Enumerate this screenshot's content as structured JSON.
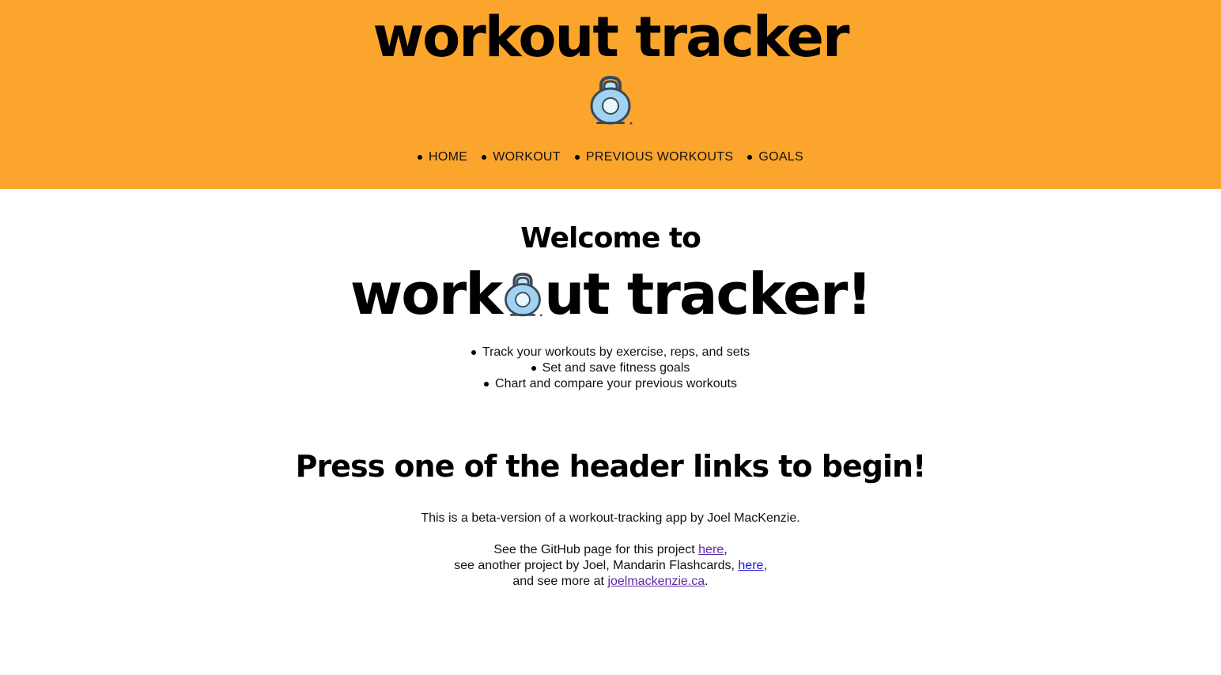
{
  "header": {
    "title": "workout tracker",
    "logo_icon": "kettlebell-icon",
    "background": "#fca52c",
    "nav": [
      {
        "label": "HOME"
      },
      {
        "label": "WORKOUT"
      },
      {
        "label": "PREVIOUS WORKOUTS"
      },
      {
        "label": "GOALS"
      }
    ]
  },
  "main": {
    "welcome": "Welcome to",
    "big_title_pre": "work",
    "big_title_post": "ut tracker!",
    "features": [
      "Track your workouts by exercise, reps, and sets",
      "Set and save fitness goals",
      "Chart and compare your previous workouts"
    ],
    "cta": "Press one of the header links to begin!",
    "beta_note": "This is a beta-version of a workout-tracking app by Joel MacKenzie.",
    "github_text": "See the GitHub page for this project ",
    "github_link": "here",
    "github_after": ",",
    "flashcards_text": "see another project by Joel, Mandarin Flashcards, ",
    "flashcards_link": "here",
    "flashcards_after": ",",
    "site_text": "and see more at ",
    "site_link": "joelmackenzie.ca",
    "site_after": "."
  }
}
